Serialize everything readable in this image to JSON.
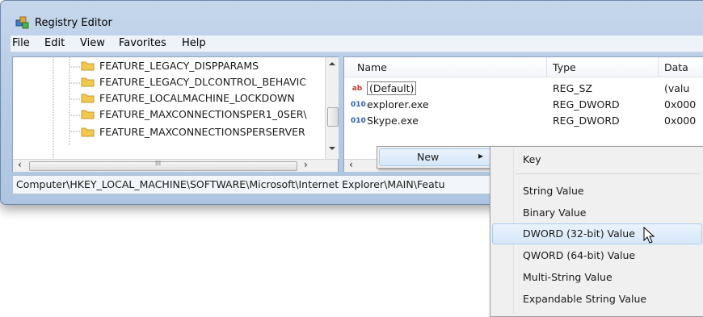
{
  "window": {
    "title": "Registry Editor"
  },
  "menu": [
    "File",
    "Edit",
    "View",
    "Favorites",
    "Help"
  ],
  "tree": {
    "items": [
      "FEATURE_LEGACY_DISPPARAMS",
      "FEATURE_LEGACY_DLCONTROL_BEHAVIC",
      "FEATURE_LOCALMACHINE_LOCKDOWN",
      "FEATURE_MAXCONNECTIONSPER1_0SER\\",
      "FEATURE_MAXCONNECTIONSPERSERVER"
    ],
    "scroll_left": "‹",
    "scroll_right": "›",
    "scroll_grip": "III"
  },
  "list": {
    "columns": [
      "Name",
      "Type",
      "Data"
    ],
    "rows": [
      {
        "icon": "ab",
        "name": "(Default)",
        "type": "REG_SZ",
        "data": "(valu"
      },
      {
        "icon": "010",
        "name": "explorer.exe",
        "type": "REG_DWORD",
        "data": "0x000"
      },
      {
        "icon": "010",
        "name": "Skype.exe",
        "type": "REG_DWORD",
        "data": "0x000"
      }
    ]
  },
  "status": "Computer\\HKEY_LOCAL_MACHINE\\SOFTWARE\\Microsoft\\Internet Explorer\\MAIN\\Featu",
  "context_menu": {
    "new_label": "New",
    "arrow": "▸"
  },
  "submenu": {
    "items": [
      "Key",
      "String Value",
      "Binary Value",
      "DWORD (32-bit) Value",
      "QWORD (64-bit) Value",
      "Multi-String Value",
      "Expandable String Value"
    ]
  },
  "icons": {
    "app": "registry-editor-icon",
    "folder": "folder-icon",
    "string_value": "string-value-icon",
    "binary_value": "binary-value-icon",
    "cursor": "mouse-cursor-icon"
  },
  "colors": {
    "highlight": "#d6e7f9",
    "folder": "#f2c94c",
    "string_icon": "#c0392b",
    "binary_icon": "#2a5db0"
  }
}
